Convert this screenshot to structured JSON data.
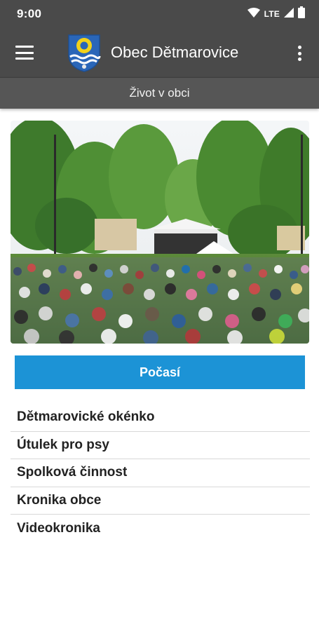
{
  "status_bar": {
    "time": "9:00",
    "network_label": "LTE",
    "icons": [
      "wifi-icon",
      "signal-icon",
      "battery-icon"
    ]
  },
  "app_bar": {
    "title": "Obec Dětmarovice",
    "menu_icon": "hamburger-menu-icon",
    "overflow_icon": "more-vert-icon",
    "logo": "municipal-coat-of-arms"
  },
  "section": {
    "title": "Život v obci"
  },
  "photo": {
    "subject": "outdoor-festival-crowd"
  },
  "weather_button": {
    "label": "Počasí"
  },
  "menu_items": [
    {
      "label": "Dětmarovické okénko"
    },
    {
      "label": "Útulek pro psy"
    },
    {
      "label": "Spolková činnost"
    },
    {
      "label": "Kronika obce"
    },
    {
      "label": "Videokronika"
    }
  ],
  "colors": {
    "app_bar": "#4a4a4a",
    "section_bar": "#565656",
    "accent": "#1c93d6",
    "text": "#222222",
    "divider": "#d8d8d8"
  }
}
